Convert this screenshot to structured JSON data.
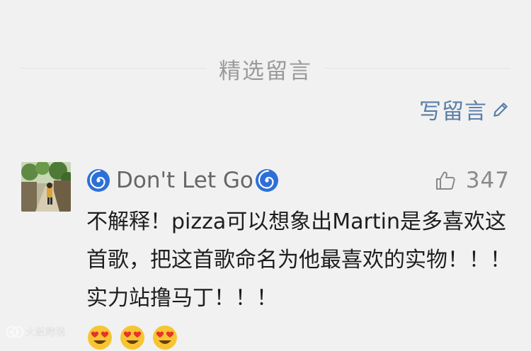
{
  "section": {
    "title": "精选留言"
  },
  "write_comment": {
    "label": "写留言",
    "icon": "pencil-icon"
  },
  "comments": [
    {
      "nickname": "Don't Let Go",
      "nickname_prefix_icon": "swirl-icon",
      "nickname_suffix_icon": "swirl-icon",
      "likes": "347",
      "like_icon": "thumbs-up-icon",
      "text": "不解释！pizza可以想象出Martin是多喜欢这首歌，把这首歌命名为他最喜欢的实物！！！实力站撸马丁！！！",
      "emojis": [
        "heart-eyes-emoji",
        "heart-eyes-emoji",
        "heart-eyes-emoji"
      ]
    }
  ],
  "watermark": {
    "text": "大鼓跨境",
    "icon": "kb-logo-icon"
  },
  "colors": {
    "background": "#f1f1f1",
    "link": "#5a7ea7",
    "muted": "#9a9a9a",
    "swirl": "#2d6fd6"
  }
}
